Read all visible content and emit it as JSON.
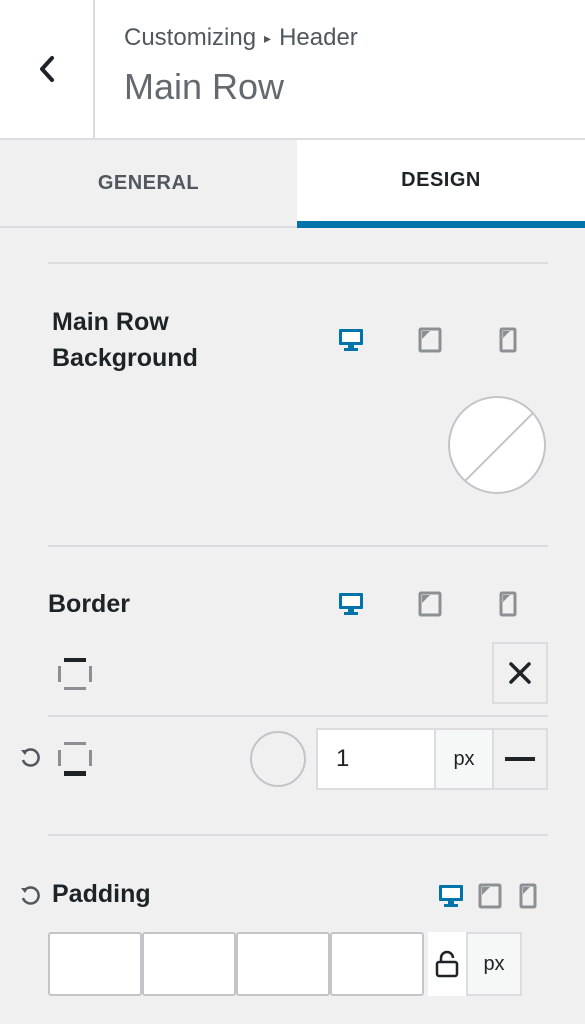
{
  "header": {
    "breadcrumb_root": "Customizing",
    "breadcrumb_separator": "▸",
    "breadcrumb_section": "Header",
    "title": "Main Row",
    "back_icon": "chevron-left-icon"
  },
  "tabs": [
    {
      "label": "GENERAL",
      "active": false
    },
    {
      "label": "DESIGN",
      "active": true
    }
  ],
  "colors": {
    "accent": "#0073aa",
    "device_inactive": "#8c8f94"
  },
  "background_section": {
    "label": "Main Row Background",
    "active_device": "desktop",
    "color_value": "none"
  },
  "border_section": {
    "label": "Border",
    "active_device": "desktop",
    "width_value": "1",
    "unit": "px"
  },
  "padding_section": {
    "label": "Padding",
    "active_device": "desktop",
    "values": [
      "",
      "",
      "",
      ""
    ],
    "unit": "px"
  }
}
